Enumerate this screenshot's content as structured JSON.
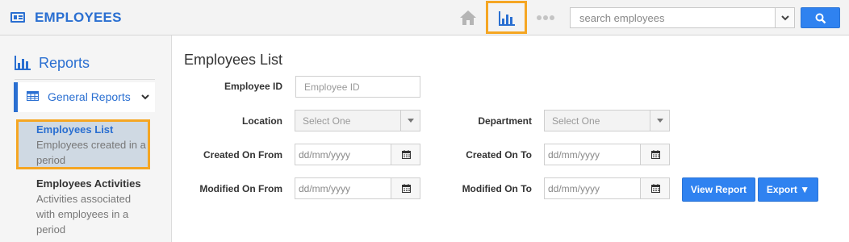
{
  "app": {
    "title": "EMPLOYEES",
    "icon": "id-card-icon"
  },
  "topnav": {
    "home_icon": "home-icon",
    "reports_icon": "bar-chart-icon",
    "more_icon": "dots-icon",
    "search": {
      "placeholder": "search employees",
      "value": ""
    },
    "search_button_icon": "search-icon"
  },
  "sidebar": {
    "section_title": "Reports",
    "group": {
      "label": "General Reports",
      "icon": "table-icon",
      "expanded": true
    },
    "items": [
      {
        "title": "Employees List",
        "description": "Employees created in a period",
        "active": true
      },
      {
        "title": "Employees Activities",
        "description": "Activities associated with employees in a period",
        "active": false
      }
    ]
  },
  "form": {
    "page_title": "Employees List",
    "employee_id": {
      "label": "Employee ID",
      "placeholder": "Employee ID"
    },
    "location": {
      "label": "Location",
      "value": "Select One"
    },
    "department": {
      "label": "Department",
      "value": "Select One"
    },
    "created_from": {
      "label": "Created On From",
      "placeholder": "dd/mm/yyyy"
    },
    "created_to": {
      "label": "Created On To",
      "placeholder": "dd/mm/yyyy"
    },
    "modified_from": {
      "label": "Modified On From",
      "placeholder": "dd/mm/yyyy"
    },
    "modified_to": {
      "label": "Modified On To",
      "placeholder": "dd/mm/yyyy"
    },
    "view_report_label": "View Report",
    "export_label": "Export ▼"
  },
  "colors": {
    "accent": "#2a6fd1",
    "button": "#2f82f0",
    "highlight": "#f5a623"
  }
}
